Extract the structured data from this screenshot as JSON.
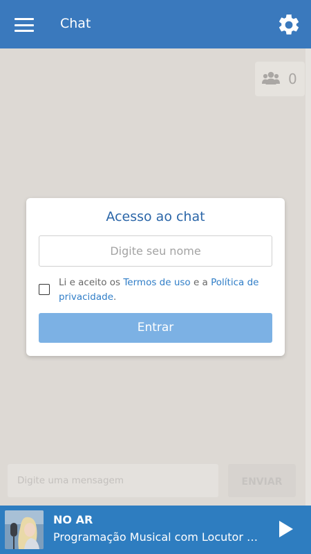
{
  "header": {
    "title": "Chat",
    "menu_icon": "hamburger-menu-icon",
    "settings_icon": "gear-icon",
    "background": "#3a79bd"
  },
  "users_online": {
    "icon": "users-icon",
    "count": "0"
  },
  "login_dialog": {
    "title": "Acesso ao chat",
    "name_placeholder": "Digite seu nome",
    "name_value": "",
    "terms_checked": false,
    "terms_prefix": "Li e aceito os ",
    "terms_link": "Termos de uso",
    "terms_middle": " e a ",
    "privacy_link": "Política de privacidade",
    "terms_suffix": ".",
    "enter_label": "Entrar",
    "accent": "#2b66a8",
    "button_color": "#7cb1e4"
  },
  "message_bar": {
    "placeholder": "Digite uma mensagem",
    "send_label": "ENVIAR"
  },
  "player": {
    "status": "NO AR",
    "program": "Programação Musical com Locutor Virtual",
    "play_icon": "play-icon",
    "background": "#2e7dc0"
  }
}
